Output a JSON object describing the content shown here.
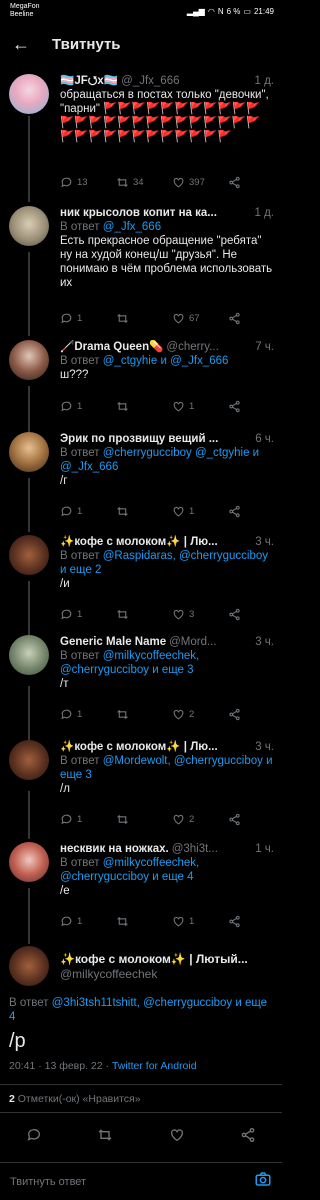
{
  "status": {
    "carrier1": "MegaFon",
    "carrier2": "Beeline",
    "battery": "6 %",
    "time": "21:49"
  },
  "header": {
    "title": "Твитнуть"
  },
  "tweets": [
    {
      "name": "🏳️‍⚧️JF⭯x🏳️‍⚧️",
      "handle": "@_Jfx_666",
      "time": "1 д.",
      "text": "обращаться в постах только \"девочки\", \"парни\" 🚩🚩🚩🚩🚩🚩🚩🚩🚩🚩🚩🚩🚩🚩🚩🚩🚩🚩🚩🚩🚩🚩🚩🚩🚩🚩🚩🚩🚩🚩🚩🚩🚩🚩🚩🚩🚩",
      "replies": "13",
      "retweets": "34",
      "likes": "397"
    },
    {
      "name": "ник крысолов копит на ка...",
      "handle": "",
      "time": "1 д.",
      "reply_prefix": "В ответ",
      "reply_to": "@_Jfx_666",
      "text": "Есть прекрасное обращение \"ребята\" ну на худой конец/ш \"друзья\". Не понимаю в чём проблема использовать их",
      "replies": "1",
      "retweets": "",
      "likes": "67"
    },
    {
      "name": "🦯Drama Queen💊",
      "handle": "@cherry...",
      "time": "7 ч.",
      "reply_prefix": "В ответ",
      "reply_to": "@_ctgyhie и @_Jfx_666",
      "text": "ш???",
      "replies": "1",
      "retweets": "",
      "likes": "1"
    },
    {
      "name": "Эрик по прозвищу вещий ...",
      "handle": "",
      "time": "6 ч.",
      "reply_prefix": "В ответ",
      "reply_to": "@cherrygucciboy @_ctgyhie и @_Jfx_666",
      "text": "/г",
      "replies": "1",
      "retweets": "",
      "likes": "1"
    },
    {
      "name": "✨кофе с молоком✨ | Лю...",
      "handle": "",
      "time": "3 ч.",
      "reply_prefix": "В ответ",
      "reply_to": "@Raspidaras, @cherrygucciboy и еще 2",
      "text": "/и",
      "replies": "1",
      "retweets": "",
      "likes": "3"
    },
    {
      "name": "Generic Male Name",
      "handle": "@Mord...",
      "time": "3 ч.",
      "reply_prefix": "В ответ",
      "reply_to": "@milkycoffeechek, @cherrygucciboy и еще 3",
      "text": "/т",
      "replies": "1",
      "retweets": "",
      "likes": "2"
    },
    {
      "name": "✨кофе с молоком✨ | Лю...",
      "handle": "",
      "time": "3 ч.",
      "reply_prefix": "В ответ",
      "reply_to": "@Mordewolt, @cherrygucciboy и еще 3",
      "text": "/л",
      "replies": "1",
      "retweets": "",
      "likes": "2"
    },
    {
      "name": "несквик на ножках.",
      "handle": "@3hi3t...",
      "time": "1 ч.",
      "reply_prefix": "В ответ",
      "reply_to": "@milkycoffeechek, @cherrygucciboy и еще 4",
      "text": "/е",
      "replies": "1",
      "retweets": "",
      "likes": "1"
    }
  ],
  "main_tweet": {
    "name": "✨кофе с молоком✨ | Лютый...",
    "handle": "@milkycoffeechek",
    "reply_prefix": "В ответ",
    "reply_to": "@3hi3tsh11tshitt, @cherrygucciboy и еще 4",
    "text": "/р",
    "time": "20:41 · 13 февр. 22 ·",
    "client": "Twitter for Android",
    "stats_count": "2",
    "stats_label": "Отметки(-ок) «Нравится»"
  },
  "reply_bar": {
    "placeholder": "Твитнуть ответ"
  }
}
